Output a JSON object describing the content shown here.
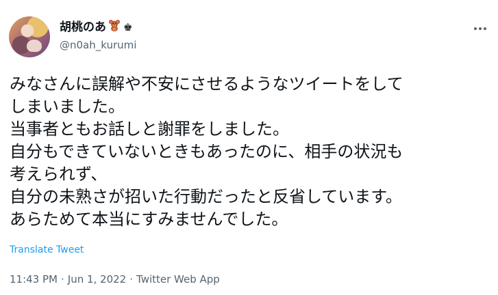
{
  "user": {
    "display_name": "胡桃のあ",
    "handle": "@n0ah_kurumi",
    "emoji_1": "teddy-bear",
    "emoji_2": "♚"
  },
  "tweet": {
    "lines": [
      "みなさんに誤解や不安にさせるようなツイートをして",
      "しまいました。",
      "当事者ともお話しと謝罪をしました。",
      "自分もできていないときもあったのに、相手の状況も",
      "考えられず、",
      "自分の未熟さが招いた行動だったと反省しています。",
      "あらためて本当にすみませんでした。"
    ],
    "translate_label": "Translate Tweet",
    "time": "11:43 PM",
    "date": "Jun 1, 2022",
    "source": "Twitter Web App",
    "separator": "·"
  },
  "colors": {
    "text": "#0f1419",
    "secondary": "#536471",
    "link": "#1d9bf0"
  }
}
